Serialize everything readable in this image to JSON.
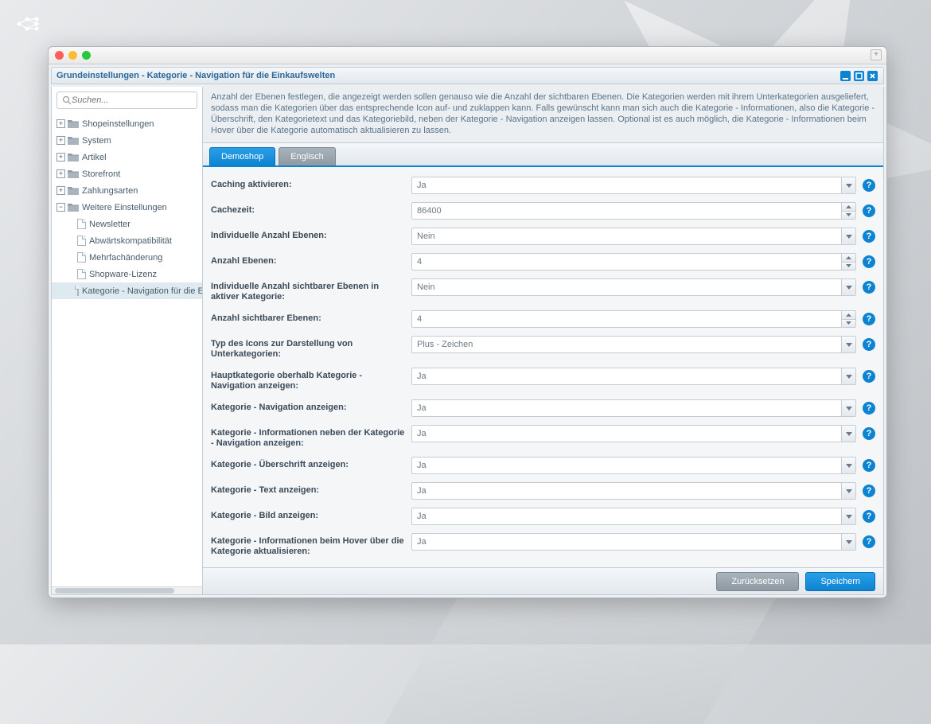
{
  "window": {
    "title": "Grundeinstellungen - Kategorie - Navigation für die Einkaufswelten"
  },
  "search": {
    "placeholder": "Suchen..."
  },
  "tree": {
    "items": [
      {
        "label": "Shopeinstellungen",
        "icon": "folder",
        "expandable": true
      },
      {
        "label": "System",
        "icon": "folder",
        "expandable": true
      },
      {
        "label": "Artikel",
        "icon": "folder",
        "expandable": true
      },
      {
        "label": "Storefront",
        "icon": "folder",
        "expandable": true
      },
      {
        "label": "Zahlungsarten",
        "icon": "folder",
        "expandable": true
      },
      {
        "label": "Weitere Einstellungen",
        "icon": "folder",
        "expandable": true,
        "expanded": true
      }
    ],
    "children": [
      {
        "label": "Newsletter"
      },
      {
        "label": "Abwärtskompatibilität"
      },
      {
        "label": "Mehrfachänderung"
      },
      {
        "label": "Shopware-Lizenz"
      },
      {
        "label": "Kategorie - Navigation für die E",
        "selected": true
      }
    ]
  },
  "info_text": "Anzahl der Ebenen festlegen, die angezeigt werden sollen genauso wie die Anzahl der sichtbaren Ebenen. Die Kategorien werden mit ihrem Unterkategorien ausgeliefert, sodass man die Kategorien über das entsprechende Icon auf- und zuklappen kann. Falls gewünscht kann man sich auch die Kategorie - Informationen, also die Kategorie - Überschrift, den Kategorietext und das Kategoriebild, neben der Kategorie - Navigation anzeigen lassen. Optional ist es auch möglich, die Kategorie - Informationen beim Hover über die Kategorie automatisch aktualisieren zu lassen.",
  "tabs": [
    {
      "label": "Demoshop",
      "active": true
    },
    {
      "label": "Englisch",
      "active": false
    }
  ],
  "fields": [
    {
      "label": "Caching aktivieren:",
      "value": "Ja",
      "type": "select"
    },
    {
      "label": "Cachezeit:",
      "value": "86400",
      "type": "spinner"
    },
    {
      "label": "Individuelle Anzahl Ebenen:",
      "value": "Nein",
      "type": "select"
    },
    {
      "label": "Anzahl Ebenen:",
      "value": "4",
      "type": "spinner"
    },
    {
      "label": "Individuelle Anzahl sichtbarer Ebenen in aktiver Kategorie:",
      "value": "Nein",
      "type": "select"
    },
    {
      "label": "Anzahl sichtbarer Ebenen:",
      "value": "4",
      "type": "spinner"
    },
    {
      "label": "Typ des Icons zur Darstellung von Unterkategorien:",
      "value": "Plus - Zeichen",
      "type": "select"
    },
    {
      "label": "Hauptkategorie oberhalb Kategorie - Navigation anzeigen:",
      "value": "Ja",
      "type": "select"
    },
    {
      "label": "Kategorie - Navigation anzeigen:",
      "value": "Ja",
      "type": "select"
    },
    {
      "label": "Kategorie - Informationen neben der Kategorie - Navigation anzeigen:",
      "value": "Ja",
      "type": "select"
    },
    {
      "label": "Kategorie - Überschrift anzeigen:",
      "value": "Ja",
      "type": "select"
    },
    {
      "label": "Kategorie - Text anzeigen:",
      "value": "Ja",
      "type": "select"
    },
    {
      "label": "Kategorie - Bild anzeigen:",
      "value": "Ja",
      "type": "select"
    },
    {
      "label": "Kategorie - Informationen beim Hover über die Kategorie aktualisieren:",
      "value": "Ja",
      "type": "select"
    }
  ],
  "buttons": {
    "reset": "Zurücksetzen",
    "save": "Speichern"
  }
}
